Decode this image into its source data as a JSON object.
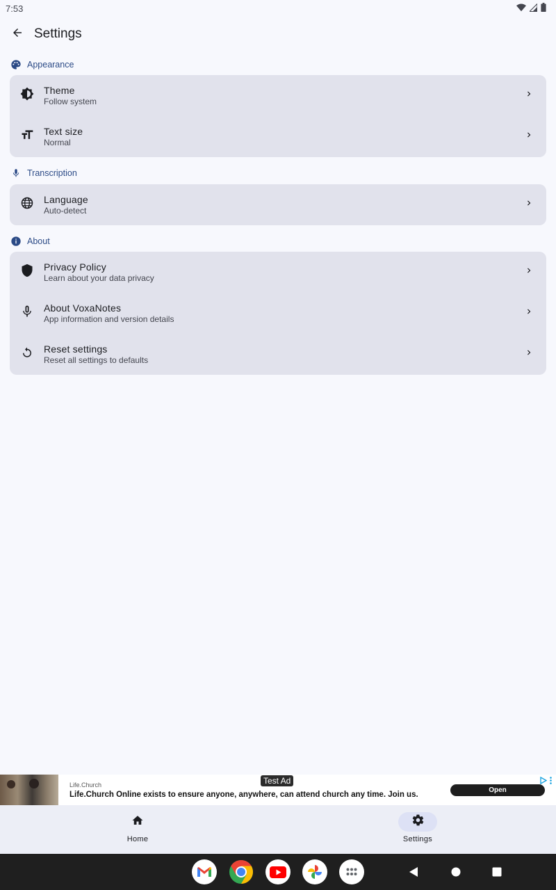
{
  "status_bar": {
    "time": "7:53"
  },
  "header": {
    "title": "Settings"
  },
  "sections": [
    {
      "title": "Appearance",
      "items": [
        {
          "title": "Theme",
          "subtitle": "Follow system"
        },
        {
          "title": "Text size",
          "subtitle": "Normal"
        }
      ]
    },
    {
      "title": "Transcription",
      "items": [
        {
          "title": "Language",
          "subtitle": "Auto-detect"
        }
      ]
    },
    {
      "title": "About",
      "items": [
        {
          "title": "Privacy Policy",
          "subtitle": "Learn about your data privacy"
        },
        {
          "title": "About VoxaNotes",
          "subtitle": "App information and version details"
        },
        {
          "title": "Reset settings",
          "subtitle": "Reset all settings to defaults"
        }
      ]
    }
  ],
  "ad": {
    "badge": "Test Ad",
    "advertiser": "Life.Church",
    "headline": "Life.Church Online exists to ensure anyone, anywhere, can attend church any time. Join us.",
    "cta": "Open"
  },
  "bottom_nav": {
    "items": [
      {
        "label": "Home",
        "icon": "home-icon",
        "active": false
      },
      {
        "label": "Settings",
        "icon": "gear-icon",
        "active": true
      }
    ]
  },
  "dock": [
    "gmail-icon",
    "chrome-icon",
    "youtube-icon",
    "photos-icon",
    "app-drawer-icon"
  ],
  "colors": {
    "background": "#f7f8fd",
    "card": "#e1e2ec",
    "section_header": "#2b4a86",
    "nav_active_pill": "#dde1f5"
  }
}
